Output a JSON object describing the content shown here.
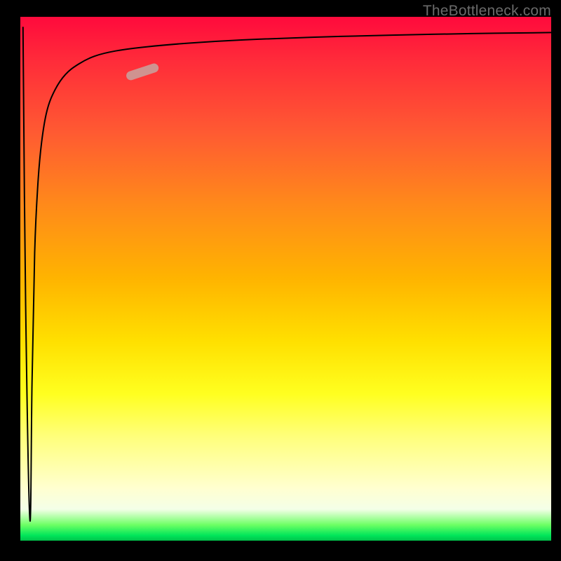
{
  "watermark": "TheBottleneck.com",
  "chart_data": {
    "type": "line",
    "title": "",
    "xlabel": "",
    "ylabel": "",
    "xlim": [
      0,
      100
    ],
    "ylim": [
      0,
      100
    ],
    "grid": false,
    "legend": false,
    "background": "red-yellow-green vertical gradient",
    "series": [
      {
        "name": "bottleneck-curve",
        "x": [
          0.5,
          1.0,
          1.8,
          2.2,
          2.7,
          3.3,
          4.0,
          5.0,
          6.5,
          8.5,
          11.0,
          14.0,
          18.0,
          24.0,
          32.0,
          42.0,
          55.0,
          70.0,
          85.0,
          100.0
        ],
        "y": [
          98.0,
          45.0,
          4.0,
          30.0,
          55.0,
          68.0,
          76.0,
          82.0,
          86.0,
          89.0,
          91.0,
          92.5,
          93.5,
          94.3,
          95.0,
          95.6,
          96.1,
          96.5,
          96.8,
          97.0
        ]
      }
    ],
    "annotations": [
      {
        "name": "highlight-segment",
        "type": "segment-marker",
        "x_range": [
          20.0,
          26.0
        ],
        "y_range": [
          88.5,
          90.5
        ],
        "color": "#cf9390"
      }
    ]
  }
}
